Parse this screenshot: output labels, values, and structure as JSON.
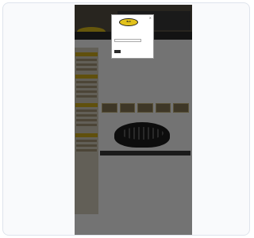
{
  "colors": {
    "brand_yellow": "#e2c21c",
    "dark_bg": "#2b2b2b",
    "overlay": "rgba(0,0,0,0.55)"
  },
  "modal": {
    "logo_text": "Bell",
    "close_glyph": "×",
    "line1": "",
    "line2": "",
    "input_placeholder": "",
    "submit_label": ""
  },
  "page": {
    "title_line": "",
    "subtitle_line": "",
    "section_heading": ""
  }
}
